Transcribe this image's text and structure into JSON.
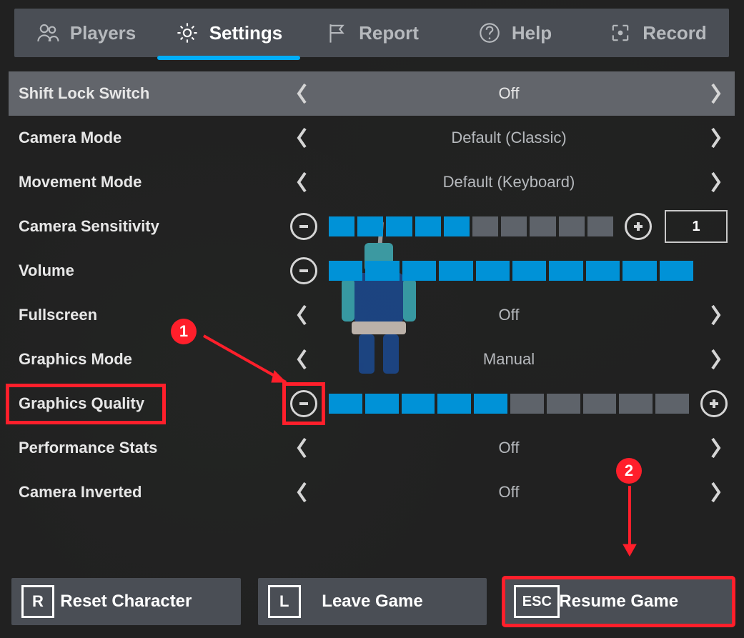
{
  "tabs": [
    {
      "id": "players",
      "label": "Players"
    },
    {
      "id": "settings",
      "label": "Settings",
      "active": true
    },
    {
      "id": "report",
      "label": "Report"
    },
    {
      "id": "help",
      "label": "Help"
    },
    {
      "id": "record",
      "label": "Record"
    }
  ],
  "settings": {
    "shift_lock": {
      "label": "Shift Lock Switch",
      "value": "Off"
    },
    "camera_mode": {
      "label": "Camera Mode",
      "value": "Default (Classic)"
    },
    "movement": {
      "label": "Movement Mode",
      "value": "Default (Keyboard)"
    },
    "sensitivity": {
      "label": "Camera Sensitivity",
      "filled": 5,
      "total": 10,
      "input": "1"
    },
    "volume": {
      "label": "Volume",
      "filled": 10,
      "total": 10
    },
    "fullscreen": {
      "label": "Fullscreen",
      "value": "Off"
    },
    "gfx_mode": {
      "label": "Graphics Mode",
      "value": "Manual"
    },
    "gfx_quality": {
      "label": "Graphics Quality",
      "filled": 5,
      "total": 10
    },
    "perf": {
      "label": "Performance Stats",
      "value": "Off"
    },
    "cam_inv": {
      "label": "Camera Inverted",
      "value": "Off"
    }
  },
  "buttons": {
    "reset": {
      "key": "R",
      "label": "Reset Character"
    },
    "leave": {
      "key": "L",
      "label": "Leave Game"
    },
    "resume": {
      "key": "ESC",
      "label": "Resume Game"
    }
  },
  "callouts": {
    "one": "1",
    "two": "2"
  }
}
